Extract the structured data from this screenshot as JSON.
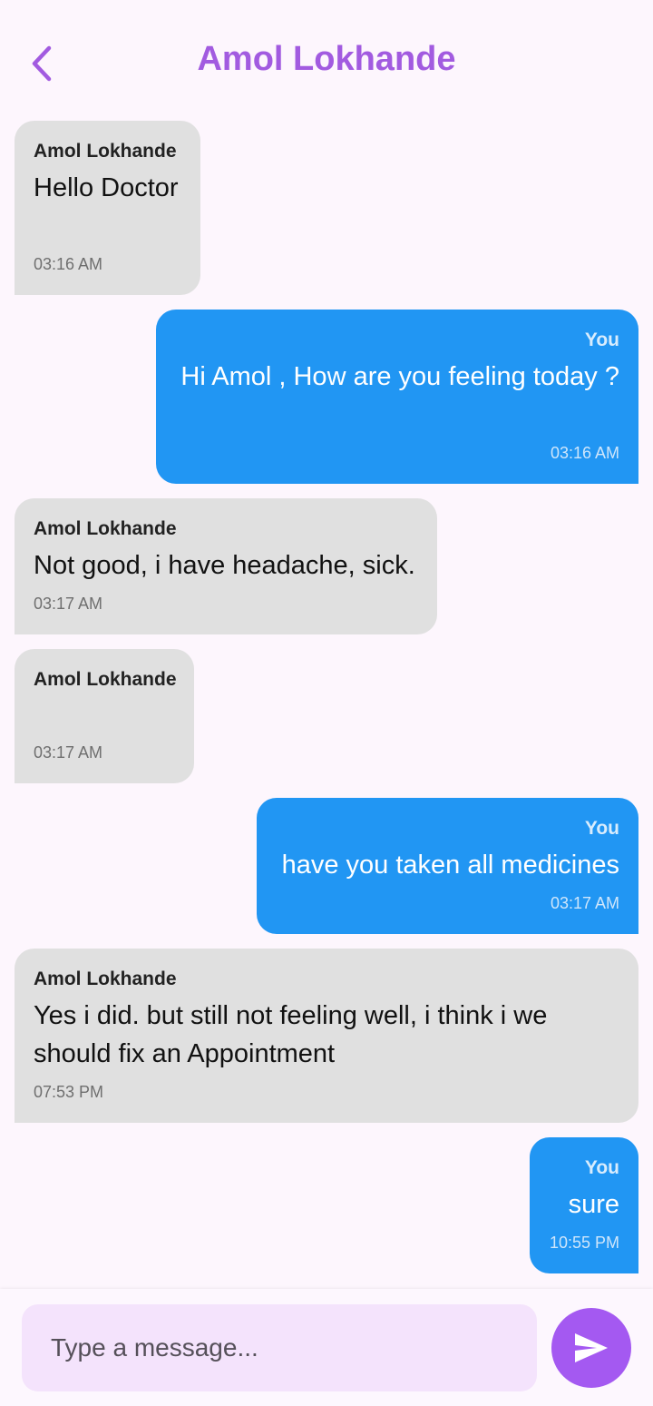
{
  "header": {
    "title": "Amol Lokhande",
    "back_icon": "chevron-left-icon",
    "accent_color": "#a25be0"
  },
  "messages": [
    {
      "direction": "incoming",
      "sender": "Amol Lokhande",
      "text": "Hello Doctor",
      "time": "03:16 AM"
    },
    {
      "direction": "outgoing",
      "sender": "You",
      "text": "Hi Amol , How are you feeling today ?",
      "time": "03:16 AM"
    },
    {
      "direction": "incoming",
      "sender": "Amol Lokhande",
      "text": "Not good, i have headache, sick.",
      "time": "03:17 AM"
    },
    {
      "direction": "incoming",
      "sender": "Amol Lokhande",
      "text": "",
      "time": "03:17 AM"
    },
    {
      "direction": "outgoing",
      "sender": "You",
      "text": "have you taken all medicines",
      "time": "03:17 AM"
    },
    {
      "direction": "incoming",
      "sender": "Amol Lokhande",
      "text": "Yes i did. but still not feeling well, i think i we should fix an Appointment",
      "time": "07:53 PM"
    },
    {
      "direction": "outgoing",
      "sender": "You",
      "text": "sure",
      "time": "10:55 PM"
    }
  ],
  "composer": {
    "placeholder": "Type a message...",
    "value": "",
    "send_icon": "send-icon"
  },
  "colors": {
    "incoming_bubble": "#e0e0e0",
    "outgoing_bubble": "#2196f3",
    "send_button": "#a459f1",
    "input_background": "#f4e3fc"
  }
}
